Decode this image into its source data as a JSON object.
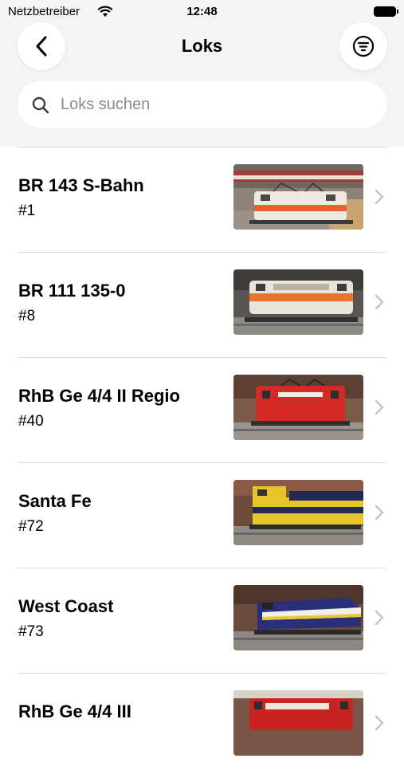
{
  "status_bar": {
    "carrier": "Netzbetreiber",
    "time": "12:48"
  },
  "nav": {
    "title": "Loks"
  },
  "search": {
    "placeholder": "Loks suchen"
  },
  "locos": [
    {
      "name": "BR 143 S-Bahn",
      "number": "#1"
    },
    {
      "name": "BR 111 135-0",
      "number": "#8"
    },
    {
      "name": "RhB Ge 4/4 II Regio",
      "number": "#40"
    },
    {
      "name": "Santa Fe",
      "number": "#72"
    },
    {
      "name": "West Coast",
      "number": "#73"
    },
    {
      "name": "RhB Ge 4/4 III",
      "number": ""
    }
  ],
  "colors": {
    "header_bg": "#f4f4f6",
    "divider": "#dcdcdf",
    "chevron": "#c4c4c7",
    "placeholder": "#8a8a8e"
  },
  "icons": [
    "wifi-icon",
    "battery-icon",
    "back-chevron-icon",
    "filter-icon",
    "search-icon",
    "chevron-right-icon"
  ]
}
